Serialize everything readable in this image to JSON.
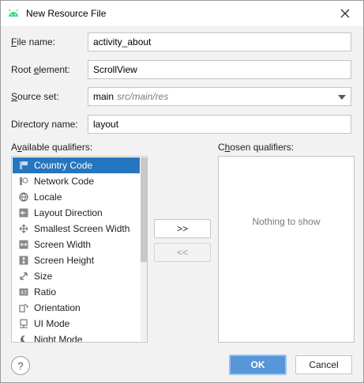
{
  "window": {
    "title": "New Resource File",
    "icon": "android-icon",
    "close_icon": "close-icon"
  },
  "form": {
    "file_name": {
      "label_u": "F",
      "label_rest": "ile name:",
      "value": "activity_about"
    },
    "root_element": {
      "label_pre": "Root ",
      "label_u": "e",
      "label_rest": "lement:",
      "value": "ScrollView"
    },
    "source_set": {
      "label_u": "S",
      "label_rest": "ource set:",
      "value": "main",
      "hint": "src/main/res"
    },
    "directory_name": {
      "label": "Directory name:",
      "value": "layout"
    }
  },
  "available": {
    "label_pre": "A",
    "label_u": "v",
    "label_rest": "ailable qualifiers:",
    "items": [
      {
        "label": "Country Code",
        "icon": "country-code-icon"
      },
      {
        "label": "Network Code",
        "icon": "network-code-icon"
      },
      {
        "label": "Locale",
        "icon": "globe-icon"
      },
      {
        "label": "Layout Direction",
        "icon": "layout-direction-icon"
      },
      {
        "label": "Smallest Screen Width",
        "icon": "smallest-width-icon"
      },
      {
        "label": "Screen Width",
        "icon": "screen-width-icon"
      },
      {
        "label": "Screen Height",
        "icon": "screen-height-icon"
      },
      {
        "label": "Size",
        "icon": "size-icon"
      },
      {
        "label": "Ratio",
        "icon": "ratio-icon"
      },
      {
        "label": "Orientation",
        "icon": "orientation-icon"
      },
      {
        "label": "UI Mode",
        "icon": "ui-mode-icon"
      },
      {
        "label": "Night Mode",
        "icon": "night-mode-icon"
      }
    ],
    "selected_index": 0
  },
  "transfer": {
    "add_label": ">>",
    "remove_label": "<<"
  },
  "chosen": {
    "label_pre": "C",
    "label_u": "h",
    "label_rest": "osen qualifiers:",
    "empty_text": "Nothing to show"
  },
  "footer": {
    "help_label": "?",
    "ok_label": "OK",
    "cancel_label": "Cancel"
  },
  "colors": {
    "selection": "#2675bf",
    "primary_button": "#5796d7",
    "android_green": "#3ddc84"
  }
}
